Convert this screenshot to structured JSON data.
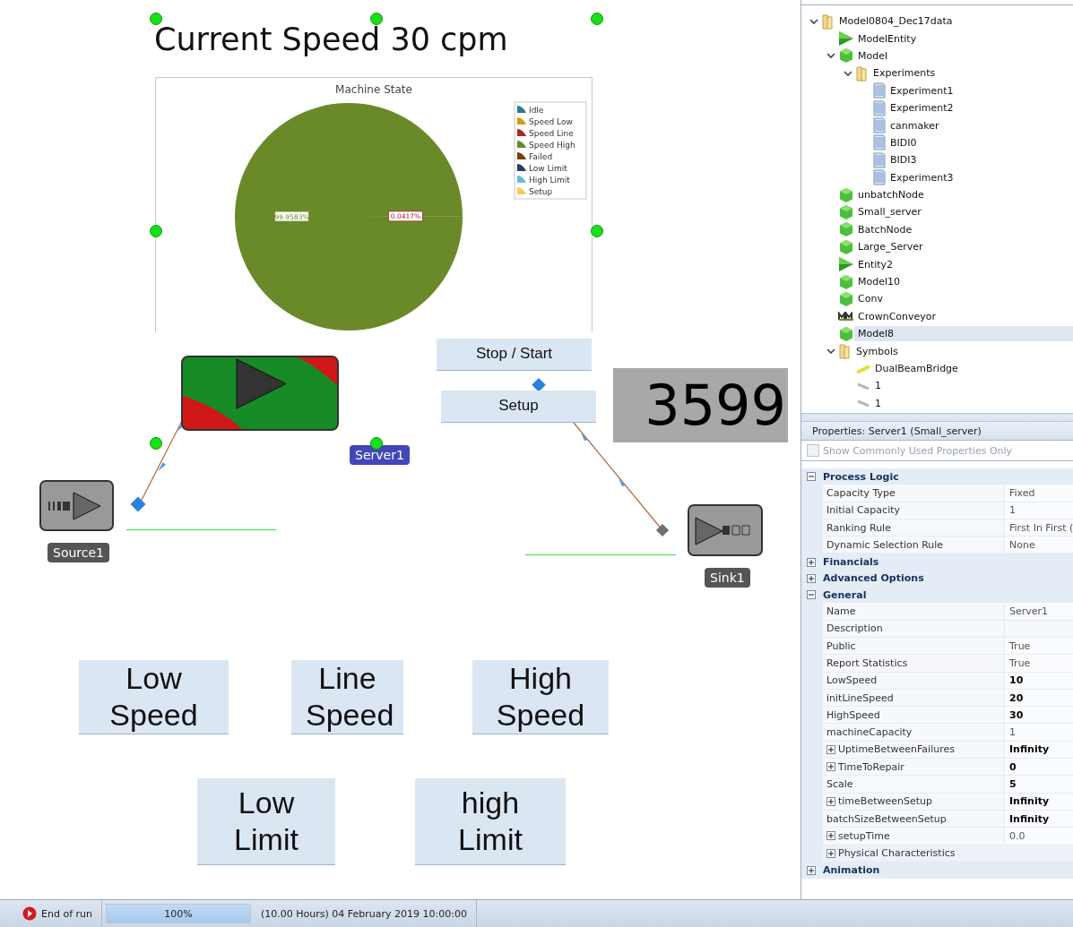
{
  "canvas": {
    "title": "Current Speed 30 cpm",
    "chart_data": {
      "type": "pie",
      "title": "Machine State",
      "categories": [
        "Idle",
        "Speed Low",
        "Speed Line",
        "Speed High",
        "Failed",
        "Low Limit",
        "High Limit",
        "Setup"
      ],
      "colors": [
        "#2e7a8a",
        "#d89a10",
        "#a8262e",
        "#6a8a2a",
        "#7a3a0a",
        "#2a3a6a",
        "#6ab8d8",
        "#f8c860"
      ],
      "values": [
        0,
        0,
        0.0417,
        99.9583,
        0,
        0,
        0,
        0
      ],
      "value_labels": [
        null,
        null,
        "0.0417%",
        "99.9583%",
        null,
        null,
        null,
        null
      ],
      "legend": true
    },
    "server": {
      "label": "Server1"
    },
    "source": {
      "label": "Source1"
    },
    "sink": {
      "label": "Sink1"
    },
    "controls": [
      {
        "label": "Stop / Start",
        "kind": "small"
      },
      {
        "label": "Setup",
        "kind": "small"
      }
    ],
    "counter": "3599",
    "speed_buttons": [
      {
        "label": "Low Speed"
      },
      {
        "label": "Line Speed"
      },
      {
        "label": "High Speed"
      }
    ],
    "limit_buttons": [
      {
        "label": "Low Limit"
      },
      {
        "label": "high Limit"
      }
    ]
  },
  "tree": [
    {
      "label": "Model0804_Dec17data",
      "kind": "folder",
      "expanded": true,
      "selected": false,
      "children": [
        {
          "label": "ModelEntity",
          "kind": "entity",
          "selected": false
        },
        {
          "label": "Model",
          "kind": "model",
          "expanded": true,
          "selected": false,
          "children": [
            {
              "label": "Experiments",
              "kind": "folder",
              "expanded": true,
              "selected": false,
              "children": [
                {
                  "label": "Experiment1",
                  "kind": "experiment",
                  "selected": false
                },
                {
                  "label": "Experiment2",
                  "kind": "experiment",
                  "selected": false
                },
                {
                  "label": "canmaker",
                  "kind": "experiment",
                  "selected": false
                },
                {
                  "label": "BIDI0",
                  "kind": "experiment",
                  "selected": false
                },
                {
                  "label": "BIDI3",
                  "kind": "experiment",
                  "selected": false
                },
                {
                  "label": "Experiment3",
                  "kind": "experiment",
                  "selected": false
                }
              ]
            }
          ]
        },
        {
          "label": "unbatchNode",
          "kind": "model",
          "selected": false
        },
        {
          "label": "Small_server",
          "kind": "model",
          "selected": false
        },
        {
          "label": "BatchNode",
          "kind": "model",
          "selected": false
        },
        {
          "label": "Large_Server",
          "kind": "model",
          "selected": false
        },
        {
          "label": "Entity2",
          "kind": "entity",
          "selected": false
        },
        {
          "label": "Model10",
          "kind": "model",
          "selected": false
        },
        {
          "label": "Conv",
          "kind": "model",
          "selected": false
        },
        {
          "label": "CrownConveyor",
          "kind": "conveyor",
          "selected": false
        },
        {
          "label": "Model8",
          "kind": "model",
          "selected": true
        },
        {
          "label": "Symbols",
          "kind": "folder",
          "expanded": true,
          "selected": false,
          "children": [
            {
              "label": "DualBeamBridge",
              "kind": "symbol",
              "selected": false
            },
            {
              "label": "1",
              "kind": "line",
              "selected": false
            },
            {
              "label": "1",
              "kind": "line",
              "selected": false
            }
          ]
        }
      ]
    }
  ],
  "properties": {
    "title": "Properties: Server1 (Small_server)",
    "filter": {
      "label": "Show Commonly Used Properties Only",
      "checked": false,
      "disabled": true
    },
    "categories": [
      {
        "name": "Process Logic",
        "expanded": true,
        "rows": [
          {
            "name": "Capacity Type",
            "value": "Fixed",
            "bold": false
          },
          {
            "name": "Initial Capacity",
            "value": "1",
            "bold": false
          },
          {
            "name": "Ranking Rule",
            "value": "First In First (",
            "bold": false
          },
          {
            "name": "Dynamic Selection Rule",
            "value": "None",
            "bold": false
          }
        ]
      },
      {
        "name": "Financials",
        "expanded": false
      },
      {
        "name": "Advanced Options",
        "expanded": false
      },
      {
        "name": "General",
        "expanded": true,
        "rows": [
          {
            "name": "Name",
            "value": "Server1",
            "bold": false
          },
          {
            "name": "Description"
          },
          {
            "name": "Public",
            "value": "True",
            "bold": false
          },
          {
            "name": "Report Statistics",
            "value": "True",
            "bold": false
          },
          {
            "name": "LowSpeed",
            "value": "10",
            "bold": true
          },
          {
            "name": "initLineSpeed",
            "value": "20",
            "bold": true
          },
          {
            "name": "HighSpeed",
            "value": "30",
            "bold": true
          },
          {
            "name": "machineCapacity",
            "value": "1",
            "bold": false
          },
          {
            "name": "UptimeBetweenFailures",
            "value": "Infinity",
            "bold": true,
            "expandable": true
          },
          {
            "name": "TimeToRepair",
            "value": "0",
            "bold": true,
            "expandable": true
          },
          {
            "name": "Scale",
            "value": "5",
            "bold": true
          },
          {
            "name": "timeBetweenSetup",
            "value": "Infinity",
            "bold": true,
            "expandable": true
          },
          {
            "name": "batchSizeBetweenSetup",
            "value": "Infinity",
            "bold": true
          },
          {
            "name": "setupTime",
            "value": "0.0",
            "bold": false,
            "expandable": true
          },
          {
            "name": "Physical Characteristics",
            "expandable": true,
            "kind": "group"
          }
        ]
      },
      {
        "name": "Animation",
        "expanded": false
      }
    ]
  },
  "status_bar": {
    "state": "End of run",
    "progress": {
      "text": "100%",
      "level": 1
    },
    "time": "(10.00 Hours) 04 February 2019 10:00:00"
  }
}
